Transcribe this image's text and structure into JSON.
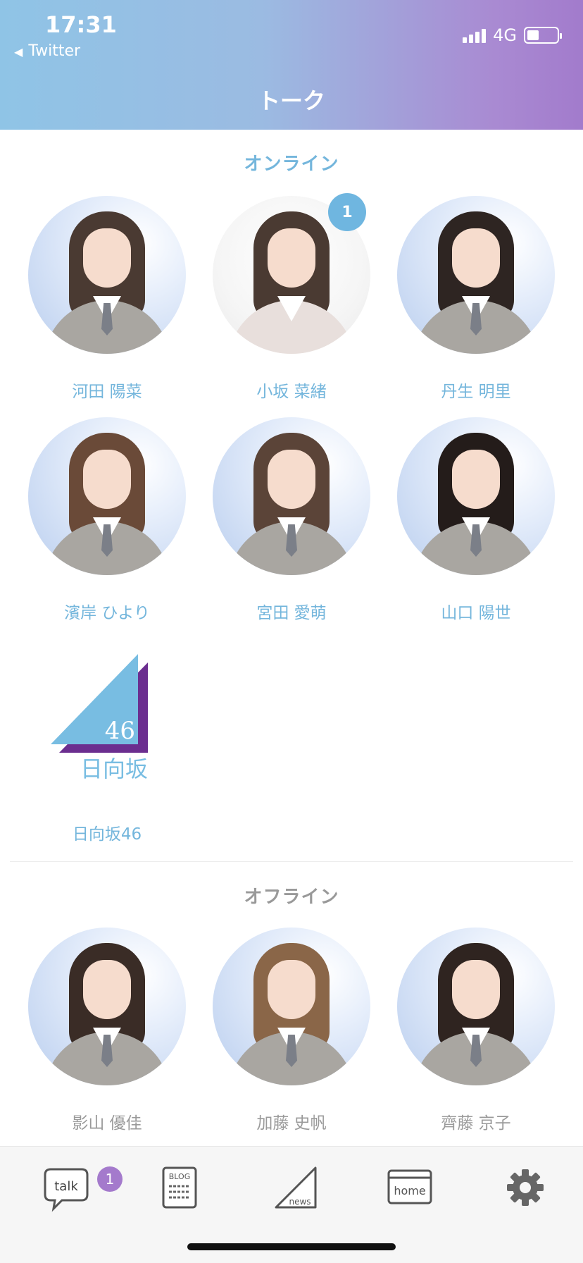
{
  "status_bar": {
    "time": "17:31",
    "back_label": "Twitter",
    "network": "4G"
  },
  "header": {
    "title": "トーク"
  },
  "online": {
    "section_title": "オンライン",
    "members": [
      {
        "name": "河田 陽菜"
      },
      {
        "name": "小坂 菜緒",
        "badge": "1"
      },
      {
        "name": "丹生 明里"
      },
      {
        "name": "濱岸 ひより"
      },
      {
        "name": "宮田 愛萌"
      },
      {
        "name": "山口 陽世"
      },
      {
        "name": "日向坂46",
        "logo_number": "46",
        "logo_text": "日向坂"
      }
    ]
  },
  "offline": {
    "section_title": "オフライン",
    "members": [
      {
        "name": "影山 優佳"
      },
      {
        "name": "加藤 史帆"
      },
      {
        "name": "齊藤 京子"
      }
    ]
  },
  "tabbar": {
    "talk_label": "talk",
    "talk_badge": "1",
    "blog_label": "BLOG",
    "news_label": "news",
    "home_label": "home"
  },
  "colors": {
    "accent_blue": "#74b6dc",
    "accent_purple": "#a47acc"
  }
}
